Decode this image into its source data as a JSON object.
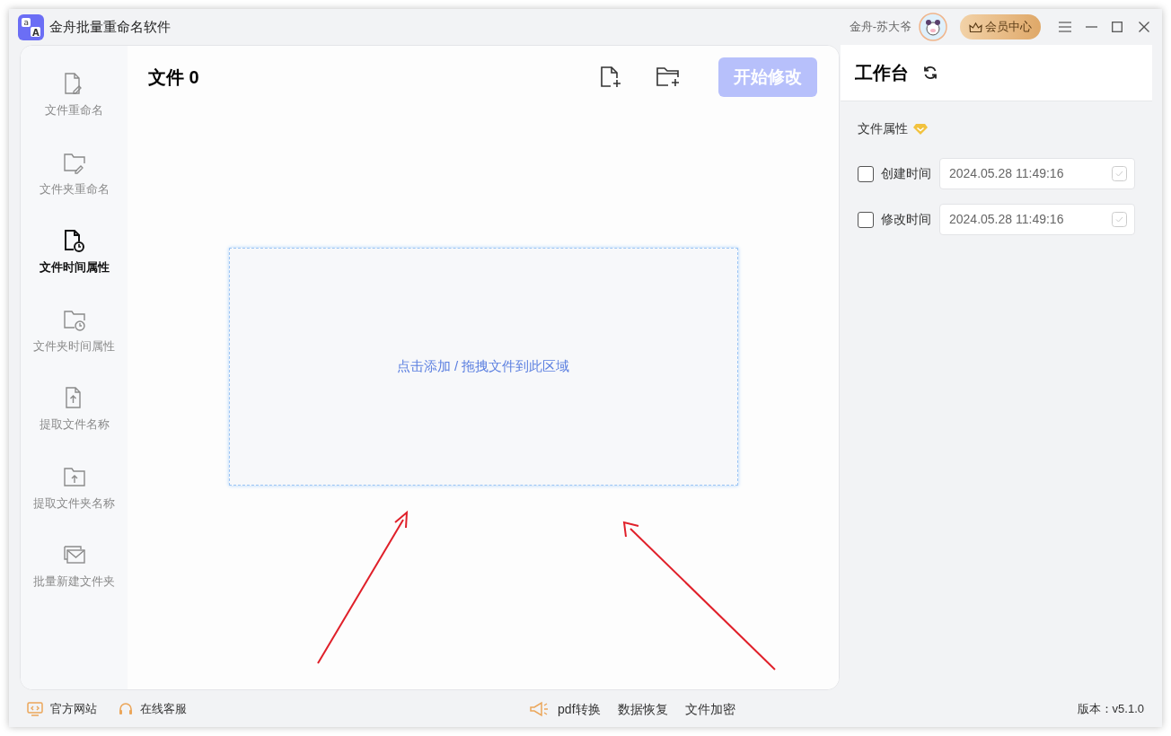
{
  "window": {
    "logo_letters": [
      "a",
      "A"
    ],
    "title": "金舟批量重命名软件",
    "user_name": "金舟-苏大爷",
    "vip_button": "会员中心"
  },
  "sidebar": {
    "items": [
      {
        "label": "文件重命名",
        "selected": false
      },
      {
        "label": "文件夹重命名",
        "selected": false
      },
      {
        "label": "文件时间属性",
        "selected": true
      },
      {
        "label": "文件夹时间属性",
        "selected": false
      },
      {
        "label": "提取文件名称",
        "selected": false
      },
      {
        "label": "提取文件夹名称",
        "selected": false
      },
      {
        "label": "批量新建文件夹",
        "selected": false
      }
    ]
  },
  "main": {
    "title": "文件 0",
    "start_button": {
      "label": "开始修改",
      "disabled": true
    },
    "drop_zone": "点击添加 / 拖拽文件到此区域"
  },
  "workbench": {
    "title": "工作台",
    "section": "文件属性",
    "fields": [
      {
        "label": "创建时间",
        "checked": false,
        "value": "2024.05.28 11:49:16"
      },
      {
        "label": "修改时间",
        "checked": false,
        "value": "2024.05.28 11:49:16"
      }
    ]
  },
  "footer": {
    "left": [
      "官方网站",
      "在线客服"
    ],
    "center": [
      "pdf转换",
      "数据恢复",
      "文件加密"
    ],
    "version": "版本：v5.1.0"
  }
}
